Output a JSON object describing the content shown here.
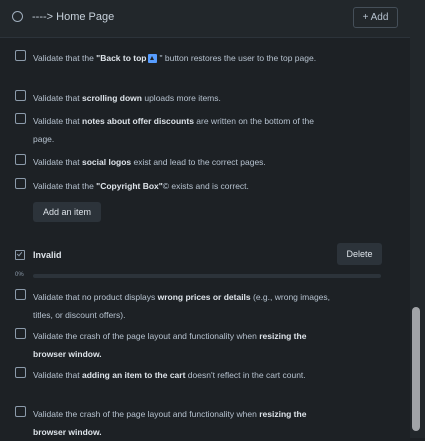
{
  "header": {
    "title": "----> Home Page",
    "add_label": "+ Add"
  },
  "checklist1": {
    "items": [
      {
        "pre": "Validate that the ",
        "bold": "\"Back to top",
        "icon": "arrow-up-icon",
        "post": "\" button restores the user to the top page."
      },
      {
        "pre": "Validate that ",
        "bold": "scrolling down",
        "post": " uploads more items."
      },
      {
        "pre": "Validate that ",
        "bold": "notes about offer discounts",
        "post": " are written on the bottom of the page."
      },
      {
        "pre": "Validate that ",
        "bold": "social logos",
        "post": " exist and lead to the correct pages."
      },
      {
        "pre": "Validate that the ",
        "bold": "\"Copyright Box\"",
        "post": "© exists and is correct."
      }
    ],
    "add_item_label": "Add an item"
  },
  "checklist2": {
    "title": "Invalid",
    "icon": "checklist-icon",
    "delete_label": "Delete",
    "progress_label": "0%",
    "progress": 0,
    "accent_color": "#579dff",
    "items": [
      {
        "pre": "Validate that no product displays ",
        "bold": "wrong prices or details",
        "post": " (e.g., wrong images, titles, or discount offers)."
      },
      {
        "pre": "Validate the crash of the page layout and functionality when ",
        "bold": "resizing the browser window.",
        "post": ""
      },
      {
        "pre": "Validate that ",
        "bold": "adding an item to the cart",
        "post": " doesn't reflect in the cart count."
      },
      {
        "pre": "Validate the crash of the page layout and functionality when ",
        "bold": "resizing the browser window.",
        "post": ""
      }
    ]
  }
}
